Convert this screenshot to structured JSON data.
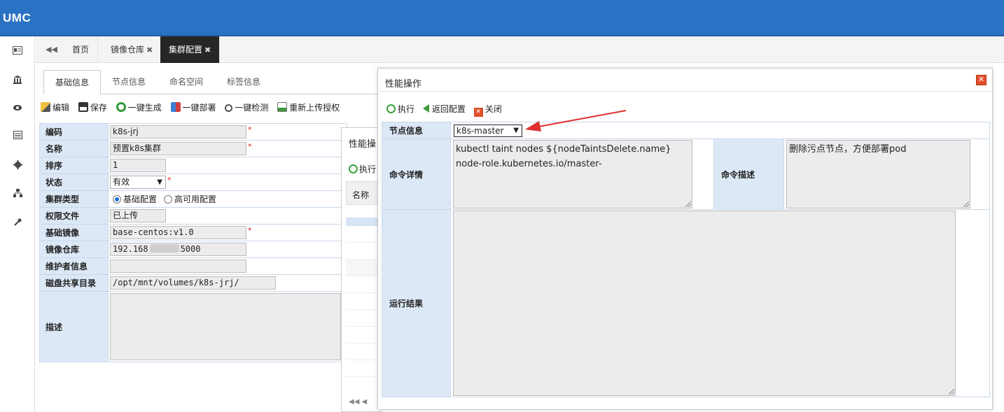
{
  "app": {
    "brand": "UMC"
  },
  "rail_icons": [
    "id-card-icon",
    "bank-icon",
    "eye-icon",
    "list-icon",
    "gear-icon",
    "network-icon",
    "wrench-icon"
  ],
  "page_tabs": {
    "back": "◀◀",
    "items": [
      {
        "label": "首页",
        "closable": false
      },
      {
        "label": "镜像仓库",
        "closable": true
      },
      {
        "label": "集群配置",
        "closable": true,
        "active": true
      }
    ],
    "close_glyph": "✖"
  },
  "inner_tabs": [
    "基础信息",
    "节点信息",
    "命名空间",
    "标签信息"
  ],
  "toolbar": {
    "edit": "编辑",
    "save": "保存",
    "generate": "一键生成",
    "deploy": "一键部署",
    "check": "一键检测",
    "reupload": "重新上传授权"
  },
  "form": {
    "code_label": "编码",
    "code_value": "k8s-jrj",
    "name_label": "名称",
    "name_value": "预置k8s集群",
    "order_label": "排序",
    "order_value": "1",
    "status_label": "状态",
    "status_value": "有效",
    "type_label": "集群类型",
    "type_opt1": "基础配置",
    "type_opt2": "高可用配置",
    "perm_label": "权限文件",
    "perm_value": "已上传",
    "image_label": "基础镜像",
    "image_value": "base-centos:v1.0",
    "repo_label": "镜像仓库",
    "repo_value_a": "192.168",
    "repo_value_b": "5000",
    "maint_label": "维护者信息",
    "maint_value": "",
    "disk_label": "磁盘共享目录",
    "disk_value": "/opt/mnt/volumes/k8s-jrj/",
    "desc_label": "描述",
    "required": "*"
  },
  "bg_dialog": {
    "title": "性能操",
    "exec": "执行",
    "name_col": "名称",
    "pager": "◀◀ ◀"
  },
  "dialog": {
    "title": "性能操作",
    "close": "✕",
    "tools": {
      "exec": "执行",
      "back": "返回配置",
      "close": "关闭"
    },
    "node_label": "节点信息",
    "node_value": "k8s-master",
    "cmd_label": "命令详情",
    "cmd_line1": "kubectl taint nodes ${nodeTaintsDelete.name}",
    "cmd_line2": "node-role.kubernetes.io/master-",
    "desc_label": "命令描述",
    "desc_value": "删除污点节点，方便部署pod",
    "result_label": "运行结果",
    "result_value": ""
  },
  "colors": {
    "topbar": "#2a72c4",
    "label_bg": "#dce8f6",
    "active_tab": "#262626",
    "arrow": "#e03030"
  }
}
